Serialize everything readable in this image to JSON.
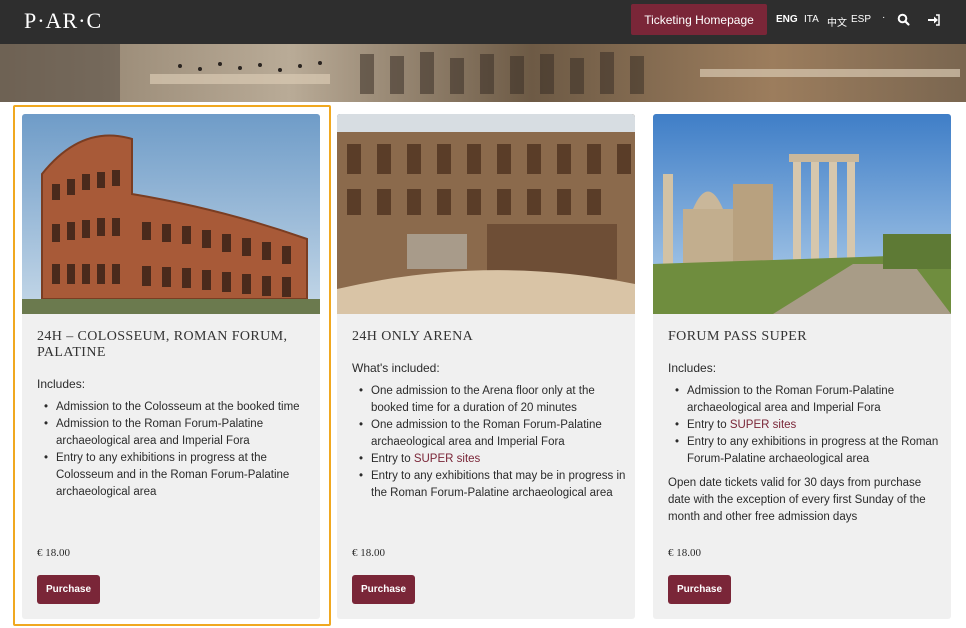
{
  "header": {
    "logo": "P·AR·C",
    "ticketing_label": "Ticketing Homepage",
    "languages": [
      "ENG",
      "ITA",
      "中文",
      "ESP"
    ],
    "active_language": "ENG",
    "dot": "·",
    "icons": [
      "search-icon",
      "login-icon"
    ]
  },
  "cards": [
    {
      "title": "24H – COLOSSEUM, ROMAN FORUM, PALATINE",
      "intro": "Includes:",
      "items": [
        "Admission to the Colosseum at the booked time",
        "Admission to the Roman Forum-Palatine archaeological area and Imperial Fora",
        "Entry to any exhibitions in progress at the Colosseum and in the Roman Forum-Palatine archaeological area"
      ],
      "price": "€ 18.00",
      "button": "Purchase"
    },
    {
      "title": "24H ONLY ARENA",
      "intro": "What's included:",
      "items": [
        "One admission to the Arena floor only at the booked time for a duration of 20 minutes",
        "One admission to the Roman Forum-Palatine archaeological area and Imperial Fora"
      ],
      "link_item_prefix": "Entry to ",
      "link_item_link": "SUPER sites",
      "items_after": [
        "Entry to any exhibitions that may be in progress in the Roman Forum-Palatine archaeological area"
      ],
      "price": "€ 18.00",
      "button": "Purchase"
    },
    {
      "title": "FORUM PASS SUPER",
      "intro": "Includes:",
      "items": [
        "Admission to the Roman Forum-Palatine archaeological area and Imperial Fora"
      ],
      "link_item_prefix": "Entry to ",
      "link_item_link": "SUPER sites",
      "items_after": [
        "Entry to any exhibitions in progress at the Roman Forum-Palatine archaeological area"
      ],
      "note": "Open date tickets valid for 30 days from purchase date with the exception of every first Sunday of the month and other free admission days",
      "price": "€ 18.00",
      "button": "Purchase"
    }
  ],
  "colors": {
    "header_bg": "#2e2e2e",
    "brand": "#7a2638",
    "card_bg": "#f0f0f0",
    "selection": "#f0a820"
  }
}
